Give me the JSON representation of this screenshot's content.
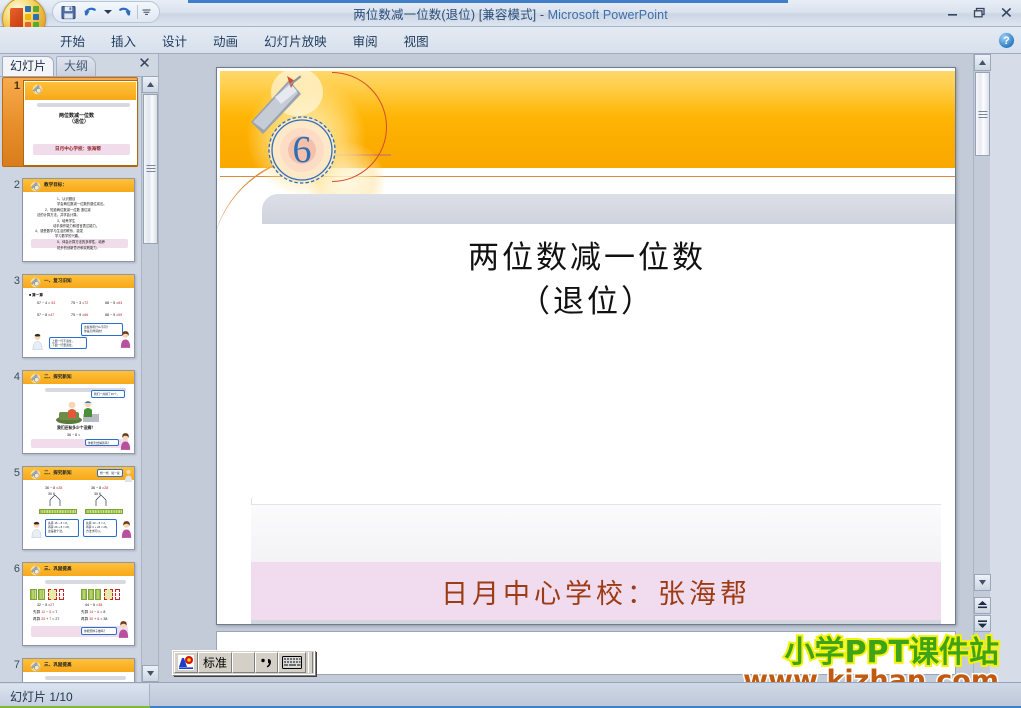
{
  "window": {
    "title_doc": "两位数减一位数(退位) [兼容模式]",
    "title_sep": " - ",
    "title_app": "Microsoft PowerPoint",
    "minimize": "—",
    "restore": "❐",
    "close": "✕"
  },
  "quick_access": {
    "save": "save-icon",
    "undo": "undo-icon",
    "undo_dropdown": "chevron-down-icon",
    "redo": "redo-icon",
    "customize": "customize-qat-icon"
  },
  "ribbon": {
    "tabs": [
      {
        "label": "开始"
      },
      {
        "label": "插入"
      },
      {
        "label": "设计"
      },
      {
        "label": "动画"
      },
      {
        "label": "幻灯片放映"
      },
      {
        "label": "审阅"
      },
      {
        "label": "视图"
      }
    ],
    "help": "?"
  },
  "left_panel": {
    "tab_slides": "幻灯片",
    "tab_outline": "大纲",
    "close": "✕",
    "thumbnails": [
      {
        "num": "1",
        "selected": true,
        "header_text": "",
        "type": "title"
      },
      {
        "num": "2",
        "selected": false,
        "header_text": "教学目标：",
        "type": "bullets"
      },
      {
        "num": "3",
        "selected": false,
        "header_text": "一、复习旧知",
        "type": "practice"
      },
      {
        "num": "4",
        "selected": false,
        "header_text": "二、探究新知",
        "type": "scene"
      },
      {
        "num": "5",
        "selected": false,
        "header_text": "二、探究新知",
        "type": "twocol"
      },
      {
        "num": "6",
        "selected": false,
        "header_text": "三、巩固提高",
        "type": "bars"
      },
      {
        "num": "7",
        "selected": false,
        "header_text": "三、巩固提高",
        "type": "partial"
      }
    ]
  },
  "slide": {
    "badge_number": "6",
    "title_line1": "两位数减一位数",
    "title_line2": "（退位）",
    "subtitle": "日月中心学校：张海帮",
    "colors": {
      "banner_orange": "#ffb808",
      "badge_blue": "#2d6fb5",
      "subtitle_red": "#9c3b14",
      "pink_band": "#f0dcee",
      "gray_band": "#d2d6df",
      "rule_orange": "#d98a3e"
    }
  },
  "ime_toolbar": {
    "ime_logo": "ime-logo-icon",
    "mode_label": "标准",
    "shape_toggle": "half-width-icon",
    "punctuation_toggle": "punctuation-icon",
    "soft_keyboard": "soft-keyboard-icon"
  },
  "watermark": {
    "line1": "小学PPT课件站",
    "line2": "www.kjzhan.com",
    "color1": "#3fa319",
    "color1_outline": "#f2f20a",
    "color2": "#c05a10"
  },
  "status_bar": {
    "slide_indicator": "幻灯片 1/10"
  },
  "scrollbars": {
    "up_arrow": "▲",
    "down_arrow": "▼",
    "prev_slide": "prev-slide-icon",
    "next_slide": "next-slide-icon"
  }
}
